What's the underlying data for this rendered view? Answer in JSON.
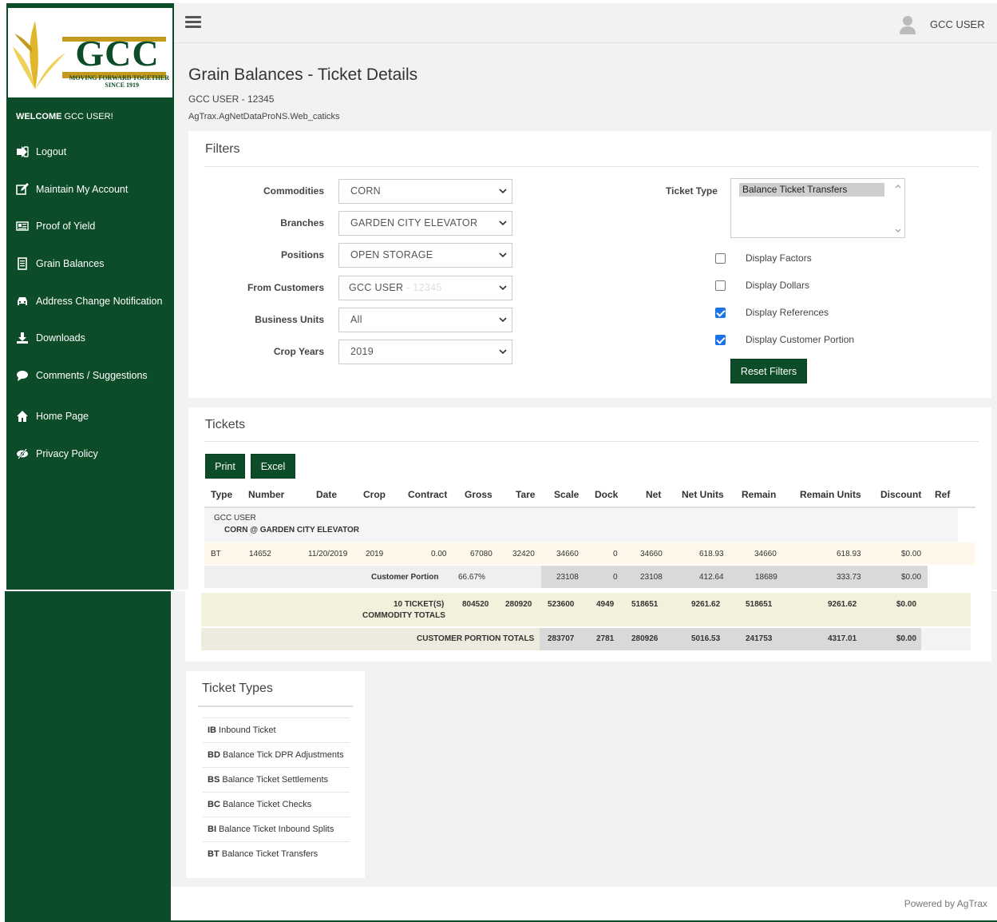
{
  "colors": {
    "brand_green": "#0d4c28",
    "gold": "#c49a1c",
    "checkbox_blue": "#1a73e8"
  },
  "logo": {
    "text": "GCC",
    "tagline_1": "MOVING FORWARD TOGETHER",
    "tagline_2": "SINCE 1919"
  },
  "sidebar": {
    "welcome_bold": "WELCOME",
    "welcome_user": " GCC USER!",
    "items": [
      {
        "label": "Logout",
        "icon": "logout-icon"
      },
      {
        "label": "Maintain My Account",
        "icon": "edit-icon"
      },
      {
        "label": "Proof of Yield",
        "icon": "newspaper-icon"
      },
      {
        "label": "Grain Balances",
        "icon": "document-icon"
      },
      {
        "label": "Address Change Notification",
        "icon": "car-icon"
      },
      {
        "label": "Downloads",
        "icon": "download-icon"
      },
      {
        "label": "Comments / Suggestions",
        "icon": "comment-icon"
      },
      {
        "label": "Home Page",
        "icon": "home-icon"
      },
      {
        "label": "Privacy Policy",
        "icon": "eye-slash-icon"
      }
    ]
  },
  "header": {
    "user": "GCC USER"
  },
  "page": {
    "title": "Grain Balances - Ticket Details",
    "user_line": "GCC USER - 12345",
    "path_line": "AgTrax.AgNetDataProNS.Web_caticks"
  },
  "filters": {
    "title": "Filters",
    "commodities_label": "Commodities",
    "commodities_value": "CORN",
    "branches_label": "Branches",
    "branches_value": "GARDEN CITY ELEVATOR",
    "positions_label": "Positions",
    "positions_value": "OPEN STORAGE",
    "customers_label": "From Customers",
    "customers_value": "GCC USER",
    "customers_id": " - 12345",
    "business_units_label": "Business Units",
    "business_units_value": "All",
    "crop_years_label": "Crop Years",
    "crop_years_value": "2019",
    "ticket_type_label": "Ticket Type",
    "ticket_type_selected": "Balance Ticket Transfers",
    "display_factors": "Display Factors",
    "display_factors_checked": false,
    "display_dollars": "Display Dollars",
    "display_dollars_checked": false,
    "display_references": "Display References",
    "display_references_checked": true,
    "display_customer_portion": "Display Customer Portion",
    "display_customer_portion_checked": true,
    "reset_button": "Reset Filters"
  },
  "tickets": {
    "title": "Tickets",
    "print_button": "Print",
    "excel_button": "Excel",
    "columns": [
      "Type",
      "Number",
      "Date",
      "Crop",
      "Contract",
      "Gross",
      "Tare",
      "Scale",
      "Dock",
      "Net",
      "Net Units",
      "Remain",
      "Remain Units",
      "Discount",
      "Ref"
    ],
    "group_customer": "GCC USER",
    "group_location": "CORN @ GARDEN CITY ELEVATOR",
    "row": {
      "type": "BT",
      "number": "14652",
      "date": "11/20/2019",
      "crop": "2019",
      "contract": "0.00",
      "gross": "67080",
      "tare": "32420",
      "scale": "34660",
      "dock": "0",
      "net": "34660",
      "net_units": "618.93",
      "remain": "34660",
      "remain_units": "618.93",
      "discount": "$0.00"
    },
    "customer_portion": {
      "label": "Customer Portion",
      "pct": "66.67%",
      "scale": "23108",
      "dock": "0",
      "net": "23108",
      "net_units": "412.64",
      "remain": "18689",
      "remain_units": "333.73",
      "discount": "$0.00"
    },
    "commodity_totals": {
      "label_1": "10 TICKET(S)",
      "label_2": "COMMODITY TOTALS",
      "gross": "804520",
      "tare": "280920",
      "scale": "523600",
      "dock": "4949",
      "net": "518651",
      "net_units": "9261.62",
      "remain": "518651",
      "remain_units": "9261.62",
      "discount": "$0.00"
    },
    "customer_totals": {
      "label": "CUSTOMER PORTION TOTALS",
      "scale": "283707",
      "dock": "2781",
      "net": "280926",
      "net_units": "5016.53",
      "remain": "241753",
      "remain_units": "4317.01",
      "discount": "$0.00"
    }
  },
  "ticket_types": {
    "title": "Ticket Types",
    "items": [
      {
        "code": "IB",
        "name": " Inbound Ticket"
      },
      {
        "code": "BD",
        "name": " Balance Tick DPR Adjustments"
      },
      {
        "code": "BS",
        "name": " Balance Ticket Settlements"
      },
      {
        "code": "BC",
        "name": " Balance Ticket Checks"
      },
      {
        "code": "BI",
        "name": " Balance Ticket Inbound Splits"
      },
      {
        "code": "BT",
        "name": " Balance Ticket Transfers"
      }
    ]
  },
  "footer": {
    "powered_by": "Powered by",
    "brand": "AgTrax"
  }
}
